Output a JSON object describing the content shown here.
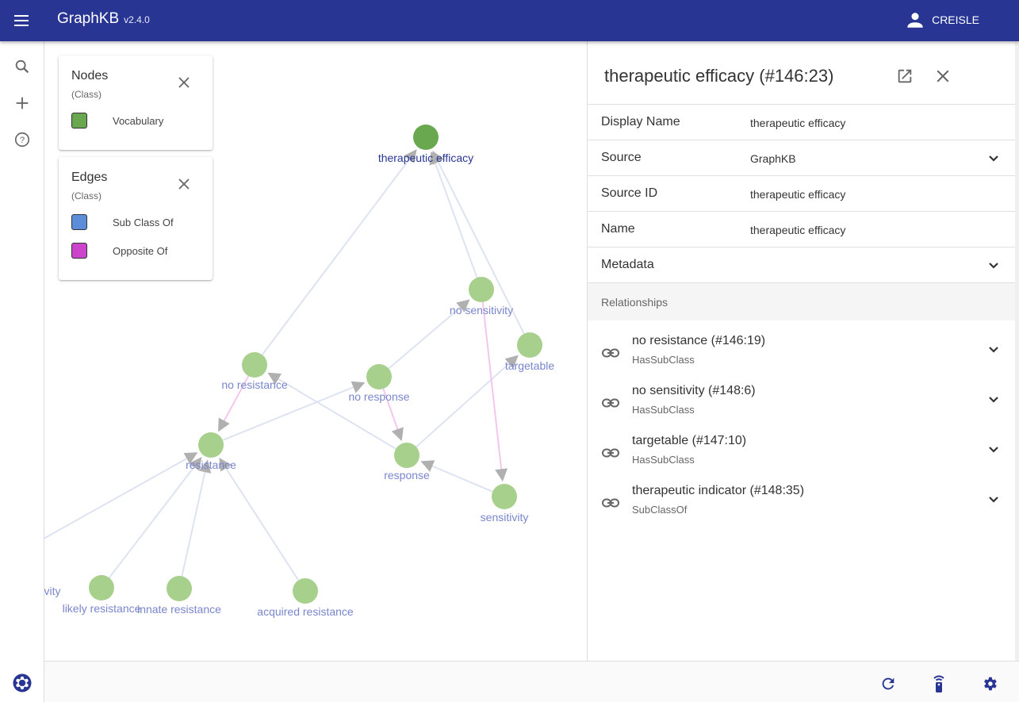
{
  "appbar": {
    "title": "GraphKB",
    "version": "v2.4.0",
    "user": "CREISLE",
    "menu_icon": "menu-icon",
    "user_icon": "person-icon"
  },
  "sidebar": {
    "items": [
      {
        "icon": "search-icon"
      },
      {
        "icon": "add-icon"
      },
      {
        "icon": "help-icon"
      }
    ]
  },
  "legend": {
    "nodes": {
      "title": "Nodes",
      "subtitle": "(Class)",
      "items": [
        {
          "label": "Vocabulary",
          "color": "#6aa84f"
        }
      ]
    },
    "edges": {
      "title": "Edges",
      "subtitle": "(Class)",
      "items": [
        {
          "label": "Sub Class Of",
          "color": "#5b8dd9"
        },
        {
          "label": "Opposite Of",
          "color": "#cc44cc"
        }
      ]
    }
  },
  "graph": {
    "colors": {
      "selected_node": "#6aa84f",
      "node": "#a8d08d",
      "selected_label": "#283593",
      "label": "#7986cb",
      "edge": "#dde3f0",
      "edge_opposite": "#f4c6ec",
      "arrow": "#b0b0b0"
    },
    "nodes": [
      {
        "id": "te",
        "label": "therapeutic efficacy",
        "selected": true
      },
      {
        "id": "ns",
        "label": "no sensitivity"
      },
      {
        "id": "tg",
        "label": "targetable"
      },
      {
        "id": "nres",
        "label": "no resistance"
      },
      {
        "id": "nrsp",
        "label": "no response"
      },
      {
        "id": "res",
        "label": "resistance"
      },
      {
        "id": "rsp",
        "label": "response"
      },
      {
        "id": "sens",
        "label": "sensitivity"
      },
      {
        "id": "lr",
        "label": "likely resistance"
      },
      {
        "id": "ir",
        "label": "innate resistance"
      },
      {
        "id": "ar",
        "label": "acquired resistance"
      },
      {
        "id": "cut",
        "label": "vity"
      }
    ]
  },
  "detail": {
    "title": "therapeutic efficacy (#146:23)",
    "open_icon": "open-in-new-icon",
    "close_icon": "close-icon",
    "properties": [
      {
        "label": "Display Name",
        "value": "therapeutic efficacy",
        "expandable": false
      },
      {
        "label": "Source",
        "value": "GraphKB",
        "expandable": true
      },
      {
        "label": "Source ID",
        "value": "therapeutic efficacy",
        "expandable": false
      },
      {
        "label": "Name",
        "value": "therapeutic efficacy",
        "expandable": false
      },
      {
        "label": "Metadata",
        "value": "",
        "expandable": true
      }
    ],
    "relationships_header": "Relationships",
    "relationships": [
      {
        "name": "no resistance (#146:19)",
        "type": "HasSubClass"
      },
      {
        "name": "no sensitivity (#148:6)",
        "type": "HasSubClass"
      },
      {
        "name": "targetable (#147:10)",
        "type": "HasSubClass"
      },
      {
        "name": "therapeutic indicator (#148:35)",
        "type": "SubClassOf"
      }
    ]
  },
  "footer": {
    "left_icon": "graphkb-logo-icon",
    "icons": [
      "refresh-icon",
      "remote-icon",
      "settings-icon"
    ]
  }
}
